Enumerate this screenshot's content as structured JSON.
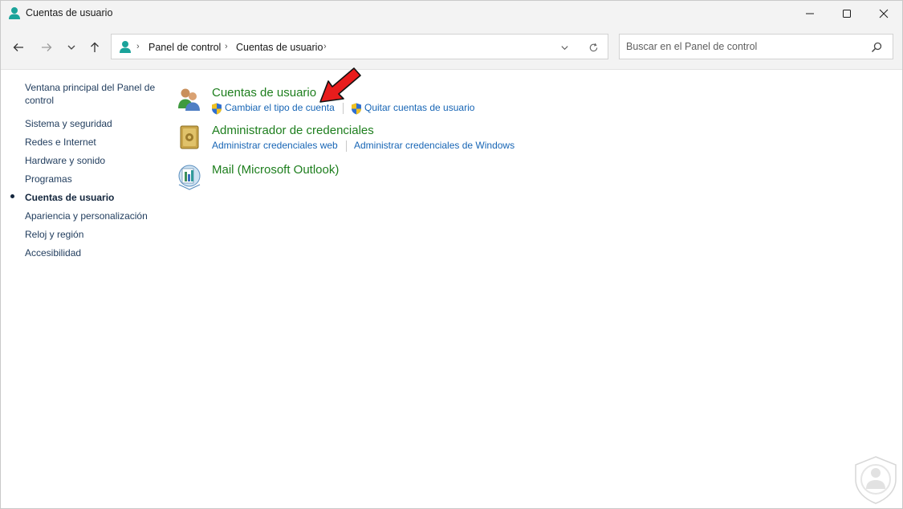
{
  "window": {
    "title": "Cuentas de usuario"
  },
  "titlebar": {
    "min_icon": "minimize-icon",
    "max_icon": "maximize-icon",
    "close_icon": "close-icon"
  },
  "nav": {
    "back_icon": "back-arrow-icon",
    "forward_icon": "forward-arrow-icon",
    "recent_icon": "chevron-down-icon",
    "up_icon": "up-arrow-icon"
  },
  "address": {
    "location_icon": "user-accounts-icon",
    "crumbs": [
      "Panel de control",
      "Cuentas de usuario"
    ],
    "dropdown_icon": "chevron-down-icon",
    "refresh_icon": "refresh-icon"
  },
  "search": {
    "placeholder": "Buscar en el Panel de control",
    "icon": "search-icon"
  },
  "sidebar": {
    "items": [
      {
        "label": "Ventana principal del Panel de control",
        "line1": "Ventana principal del Panel de",
        "line2": "control",
        "active": false
      },
      {
        "label": "Sistema y seguridad",
        "active": false
      },
      {
        "label": "Redes e Internet",
        "active": false
      },
      {
        "label": "Hardware y sonido",
        "active": false
      },
      {
        "label": "Programas",
        "active": false
      },
      {
        "label": "Cuentas de usuario",
        "active": true
      },
      {
        "label": "Apariencia y personalización",
        "active": false
      },
      {
        "label": "Reloj y región",
        "active": false
      },
      {
        "label": "Accesibilidad",
        "active": false
      }
    ]
  },
  "categories": [
    {
      "title": "Cuentas de usuario",
      "icon": "user-accounts-icon",
      "links": [
        {
          "label": "Cambiar el tipo de cuenta",
          "shield": true
        },
        {
          "label": "Quitar cuentas de usuario",
          "shield": true
        }
      ]
    },
    {
      "title": "Administrador de credenciales",
      "icon": "credential-manager-icon",
      "links": [
        {
          "label": "Administrar credenciales web",
          "shield": false
        },
        {
          "label": "Administrar credenciales de Windows",
          "shield": false
        }
      ]
    },
    {
      "title": "Mail (Microsoft Outlook)",
      "icon": "mail-icon",
      "links": []
    }
  ],
  "annotation": {
    "arrow_color": "#e81c1c"
  },
  "colors": {
    "category_title": "#1d7e1d",
    "task_link": "#1765b5",
    "sidebar_link": "#1f3b5c",
    "chrome_bg": "#f3f3f3"
  }
}
